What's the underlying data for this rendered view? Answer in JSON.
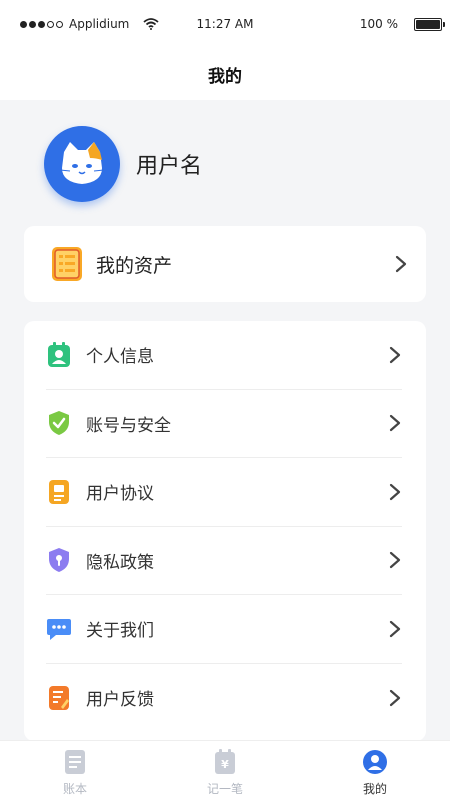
{
  "status_bar": {
    "carrier": "Applidium",
    "time": "11:27 AM",
    "battery": "100 %"
  },
  "nav": {
    "title": "我的"
  },
  "profile": {
    "username": "用户名"
  },
  "assets": {
    "label": "我的资产"
  },
  "menu": {
    "items": [
      {
        "label": "个人信息",
        "icon": "id-card-icon"
      },
      {
        "label": "账号与安全",
        "icon": "shield-check-icon"
      },
      {
        "label": "用户协议",
        "icon": "document-icon"
      },
      {
        "label": "隐私政策",
        "icon": "privacy-shield-icon"
      },
      {
        "label": "关于我们",
        "icon": "chat-bubble-icon"
      },
      {
        "label": "用户反馈",
        "icon": "feedback-icon"
      }
    ]
  },
  "tab_bar": {
    "tabs": [
      {
        "label": "账本",
        "icon": "ledger-icon",
        "active": false
      },
      {
        "label": "记一笔",
        "icon": "record-icon",
        "active": false
      },
      {
        "label": "我的",
        "icon": "profile-icon",
        "active": true
      }
    ]
  },
  "colors": {
    "background": "#f4f5f7",
    "avatar": "#2f6fe6",
    "accent_green": "#2ec27e",
    "accent_orange": "#f5a623",
    "tab_inactive": "#b3b8c2"
  }
}
